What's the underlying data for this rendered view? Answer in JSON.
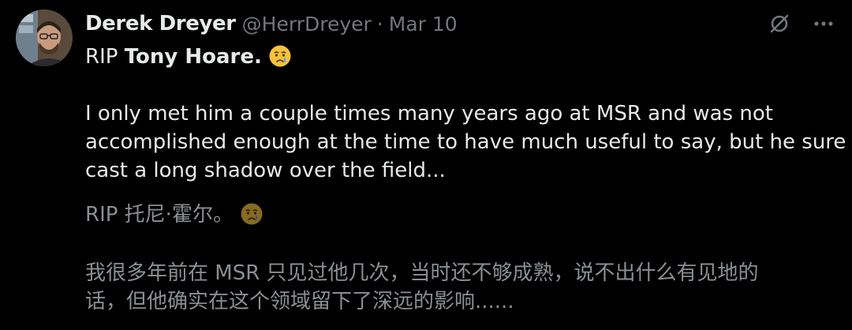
{
  "tweet": {
    "author": {
      "display_name": "Derek Dreyer",
      "handle": "@HerrDreyer",
      "separator": "·",
      "date": "Mar 10"
    },
    "actions": [
      "grok-icon",
      "more-icon"
    ],
    "english": {
      "line1_prefix": "RIP ",
      "line1_bold": "Tony Hoare.",
      "line1_emoji": "crying-face-emoji",
      "para_line1": "I only met him a couple times many years ago at MSR and was not",
      "para_line2": "accomplished enough at the time to have much useful to say, but he sure",
      "para_line3": "cast a long shadow over the field..."
    },
    "translation": {
      "line1": "RIP 托尼·霍尔。",
      "line1_emoji": "crying-face-emoji",
      "para_line1": "我很多年前在 MSR 只见过他几次，当时还不够成熟，说不出什么有见地的",
      "para_line2": "话，但他确实在这个领域留下了深远的影响......"
    }
  }
}
